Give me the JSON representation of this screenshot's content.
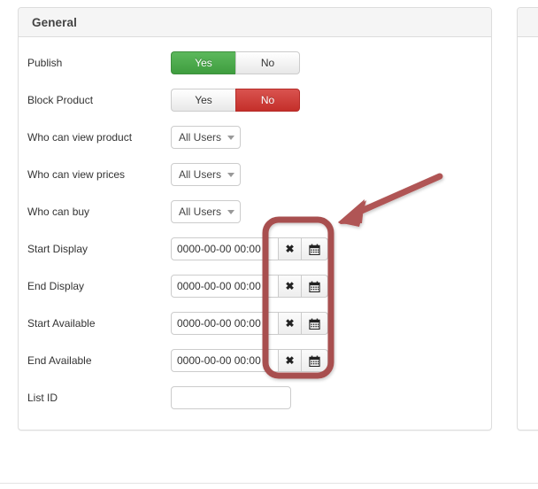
{
  "panels": {
    "general": {
      "title": "General",
      "rows": [
        {
          "label": "Publish",
          "type": "toggle",
          "options": [
            "Yes",
            "No"
          ],
          "selected": "Yes",
          "state_color": "#4aa24a"
        },
        {
          "label": "Block Product",
          "type": "toggle",
          "options": [
            "Yes",
            "No"
          ],
          "selected": "No",
          "state_color": "#cc3028"
        },
        {
          "label": "Who can view product",
          "type": "select",
          "value": "All Users",
          "icon": "chevron-down-icon"
        },
        {
          "label": "Who can view prices",
          "type": "select",
          "value": "All Users",
          "icon": "chevron-down-icon"
        },
        {
          "label": "Who can buy",
          "type": "select",
          "value": "All Users",
          "icon": "chevron-down-icon"
        },
        {
          "label": "Start Display",
          "type": "datetime",
          "value": "0000-00-00 00:00",
          "clear_icon": "close-icon",
          "calendar_icon": "calendar-icon"
        },
        {
          "label": "End Display",
          "type": "datetime",
          "value": "0000-00-00 00:00",
          "clear_icon": "close-icon",
          "calendar_icon": "calendar-icon"
        },
        {
          "label": "Start Available",
          "type": "datetime",
          "value": "0000-00-00 00:00",
          "clear_icon": "close-icon",
          "calendar_icon": "calendar-icon"
        },
        {
          "label": "End Available",
          "type": "datetime",
          "value": "0000-00-00 00:00",
          "clear_icon": "close-icon",
          "calendar_icon": "calendar-icon"
        },
        {
          "label": "List ID",
          "type": "text",
          "value": "",
          "placeholder": ""
        }
      ]
    },
    "secondary": {
      "title": ""
    }
  },
  "annotation": {
    "highlight_color": "#a85050",
    "arrow_color": "#b05555",
    "shape": "rounded-rectangle",
    "target": "date-field-buttons"
  }
}
